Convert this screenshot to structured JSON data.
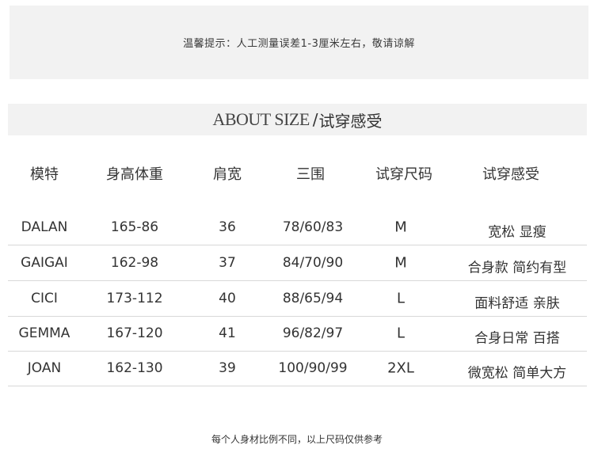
{
  "notice": "温馨提示：人工测量误差1-3厘米左右，敬请谅解",
  "heading": {
    "en": "ABOUT SIZE",
    "separator": "/",
    "cn": "试穿感受"
  },
  "table": {
    "headers": [
      "模特",
      "身高体重",
      "肩宽",
      "三围",
      "试穿尺码",
      "试穿感受"
    ],
    "rows": [
      [
        "DALAN",
        "165-86",
        "36",
        "78/60/83",
        "M",
        "宽松 显瘦"
      ],
      [
        "GAIGAI",
        "162-98",
        "37",
        "84/70/90",
        "M",
        "合身款 简约有型"
      ],
      [
        "CICI",
        "173-112",
        "40",
        "88/65/94",
        "L",
        "面料舒适 亲肤"
      ],
      [
        "GEMMA",
        "167-120",
        "41",
        "96/82/97",
        "L",
        "合身日常 百搭"
      ],
      [
        "JOAN",
        "162-130",
        "39",
        "100/90/99",
        "2XL",
        "微宽松 简单大方"
      ]
    ]
  },
  "footer": "每个人身材比例不同，以上尺码仅供参考"
}
